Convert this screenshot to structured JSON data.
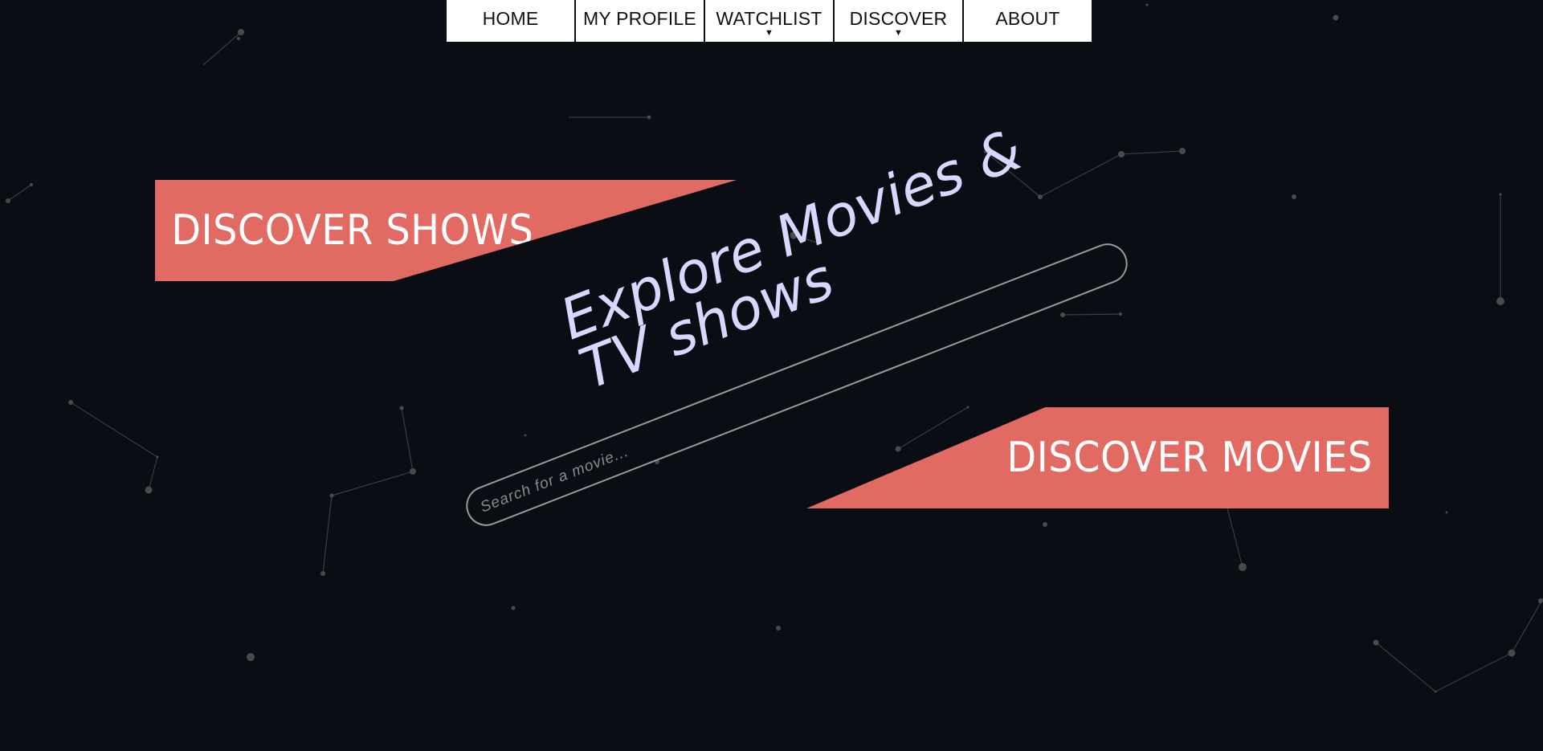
{
  "nav": {
    "items": [
      {
        "label": "HOME",
        "has_dropdown": false
      },
      {
        "label": "MY PROFILE",
        "has_dropdown": false
      },
      {
        "label": "WATCHLIST",
        "has_dropdown": true
      },
      {
        "label": "DISCOVER",
        "has_dropdown": true
      },
      {
        "label": "ABOUT",
        "has_dropdown": false
      }
    ],
    "caret": "▼"
  },
  "hero": {
    "headline": "Explore Movies &\nTV shows",
    "search_placeholder": "Search for a movie...",
    "discover_shows_label": "DISCOVER SHOWS",
    "discover_movies_label": "DISCOVER MOVIES"
  },
  "colors": {
    "background": "#0a0d14",
    "banner": "#e16b63",
    "headline": "#d6d8ff",
    "constellation": "#4a4a4a"
  }
}
